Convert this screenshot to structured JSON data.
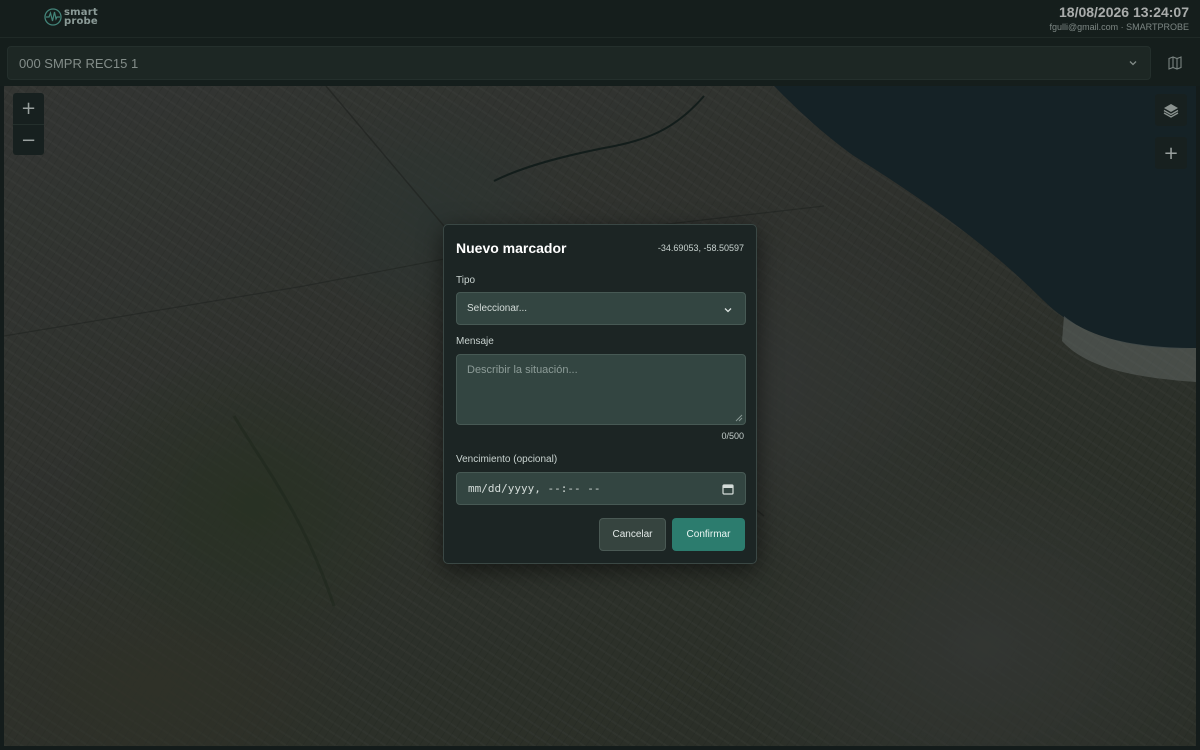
{
  "app": {
    "logo_text_line1": "smart",
    "logo_text_line2": "probe"
  },
  "header": {
    "datetime": "18/08/2026 13:24:07",
    "account": "fgulli@gmail.com · SMARTPROBE"
  },
  "device_selector": {
    "value": "000 SMPR REC15 1"
  },
  "map_controls": {
    "zoom_in": "+",
    "zoom_out": "−",
    "add": "+"
  },
  "modal": {
    "title": "Nuevo marcador",
    "coordinates": "-34.69053, -58.50597",
    "type_label": "Tipo",
    "type_value": "Seleccionar...",
    "message_label": "Mensaje",
    "message_placeholder": "Describir la situación...",
    "char_counter": "0/500",
    "expiry_label": "Vencimiento (opcional)",
    "expiry_value": "mm/dd/yyyy, --:-- --",
    "cancel_label": "Cancelar",
    "confirm_label": "Confirmar"
  },
  "colors": {
    "accent": "#2c7c6e",
    "background": "#1c2524",
    "field": "#334541"
  }
}
